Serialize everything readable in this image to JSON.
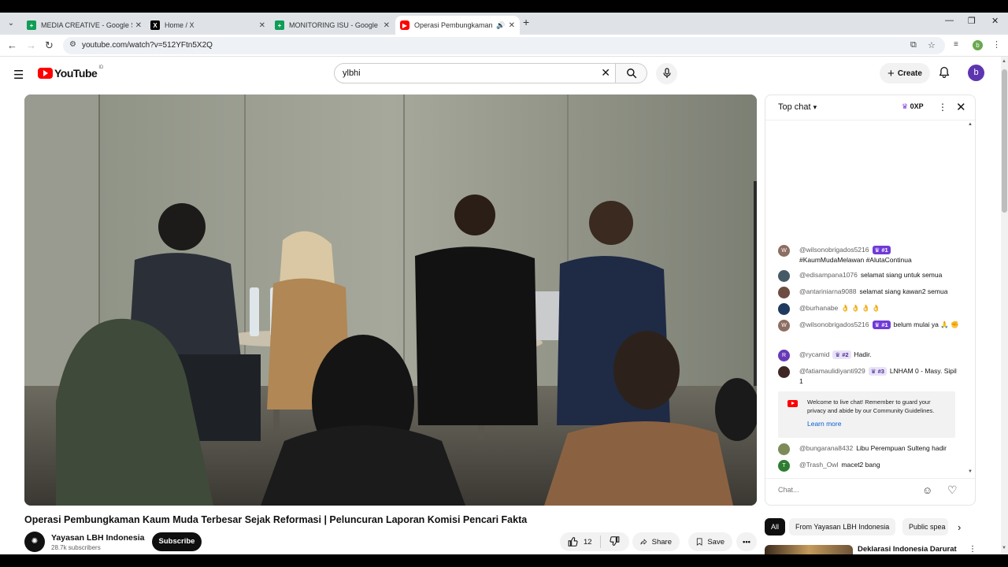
{
  "browser": {
    "tabs": [
      {
        "title": "MEDIA CREATIVE - Google Sheets",
        "favicon": "sheets-icon",
        "color": "#0f9d58"
      },
      {
        "title": "Home / X",
        "favicon": "x-icon",
        "color": "#000000"
      },
      {
        "title": "MONITORING ISU - Google Sheets",
        "favicon": "sheets-icon",
        "color": "#0f9d58"
      },
      {
        "title": "Operasi Pembungkaman Kaum Muda",
        "favicon": "youtube-icon",
        "color": "#ff0000"
      }
    ],
    "url": "youtube.com/watch?v=512YFtn5X2Q",
    "profile_initial": "b"
  },
  "youtube": {
    "logo_text": "YouTube",
    "country_code": "ID",
    "search_value": "ylbhi",
    "create_label": "Create",
    "avatar_initial": "b",
    "video": {
      "title": "Operasi Pembungkaman Kaum Muda Terbesar Sejak Reformasi | Peluncuran Laporan Komisi Pencari Fakta",
      "channel_name": "Yayasan LBH Indonesia",
      "subscribers": "28.7k subscribers",
      "subscribe_label": "Subscribe",
      "like_count": "12",
      "share_label": "Share",
      "save_label": "Save"
    },
    "chat": {
      "mode_label": "Top chat",
      "xp_label": "0XP",
      "messages": [
        {
          "user": "@wilsonobrigados5216",
          "badge": "#1",
          "text": "#KaumMudaMelawan #AlutaContinua",
          "avatar_color": "#8d6e63",
          "initial": "W"
        },
        {
          "user": "@edisampana1076",
          "badge": "",
          "text": "selamat siang untuk semua",
          "avatar_color": "#455a64",
          "initial": ""
        },
        {
          "user": "@antariniarna9088",
          "badge": "",
          "text": "selamat siang kawan2 semua",
          "avatar_color": "#6d4c41",
          "initial": ""
        },
        {
          "user": "@burhanabe",
          "badge": "",
          "text": "👌 👌 👌 👌",
          "avatar_color": "#1e3a5f",
          "initial": ""
        },
        {
          "user": "@wilsonobrigados5216",
          "badge": "#1",
          "text": "belum mulai ya 🙏 ✊",
          "avatar_color": "#8d6e63",
          "initial": "W"
        },
        {
          "user": "@rycamid",
          "badge": "#2",
          "text": "Hadir.",
          "avatar_color": "#673ab7",
          "initial": "R"
        },
        {
          "user": "@fatiamaulidiyanti929",
          "badge": "#3",
          "text": "LNHAM 0 - Masy. Sipil 1",
          "avatar_color": "#3e2723",
          "initial": ""
        },
        {
          "user": "@bungarana8432",
          "badge": "",
          "text": "Libu Perempuan Sulteng hadir",
          "avatar_color": "#7d8b5a",
          "initial": ""
        },
        {
          "user": "@Trash_Owl",
          "badge": "",
          "text": "macet2 bang",
          "avatar_color": "#2e7d32",
          "initial": "T"
        }
      ],
      "welcome_text": "Welcome to live chat! Remember to guard your privacy and abide by our Community Guidelines.",
      "learn_more": "Learn more",
      "input_placeholder": "Chat..."
    },
    "chips": [
      "All",
      "From Yayasan LBH Indonesia",
      "Public spea"
    ],
    "recommendation_title": "Deklarasi Indonesia Darurat"
  }
}
